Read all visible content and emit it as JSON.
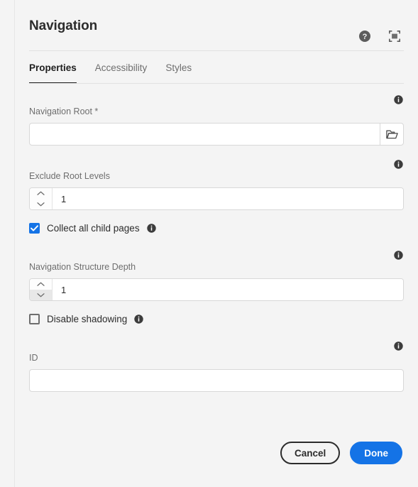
{
  "dialog": {
    "title": "Navigation",
    "header_actions": [
      {
        "name": "help-icon",
        "label": "Help"
      },
      {
        "name": "fullscreen-icon",
        "label": "Full screen"
      }
    ],
    "tabs": [
      {
        "label": "Properties",
        "active": true
      },
      {
        "label": "Accessibility",
        "active": false
      },
      {
        "label": "Styles",
        "active": false
      }
    ],
    "fields": {
      "navigation_root": {
        "label": "Navigation Root *",
        "value": "",
        "placeholder": "",
        "browse_icon": "folder-icon",
        "info_icon": "info-icon"
      },
      "exclude_root_levels": {
        "label": "Exclude Root Levels",
        "value": "1",
        "info_icon": "info-icon",
        "increment_icon": "chevron-up-icon",
        "decrement_icon": "chevron-down-icon"
      },
      "collect_all_child_pages": {
        "label": "Collect all child pages",
        "checked": true,
        "info_icon": "info-icon"
      },
      "navigation_structure_depth": {
        "label": "Navigation Structure Depth",
        "value": "1",
        "info_icon": "info-icon",
        "increment_icon": "chevron-up-icon",
        "decrement_icon": "chevron-down-icon"
      },
      "disable_shadowing": {
        "label": "Disable shadowing",
        "checked": false,
        "info_icon": "info-icon"
      },
      "id": {
        "label": "ID",
        "value": "",
        "placeholder": "",
        "info_icon": "info-icon"
      }
    },
    "footer": {
      "cancel_label": "Cancel",
      "done_label": "Done"
    },
    "colors": {
      "accent": "#1473E6",
      "text": "#2C2C2C",
      "muted_text": "#6E6E6E",
      "background": "#F4F4F4",
      "field_background": "#FFFFFF",
      "border": "#D8D8D8"
    }
  }
}
